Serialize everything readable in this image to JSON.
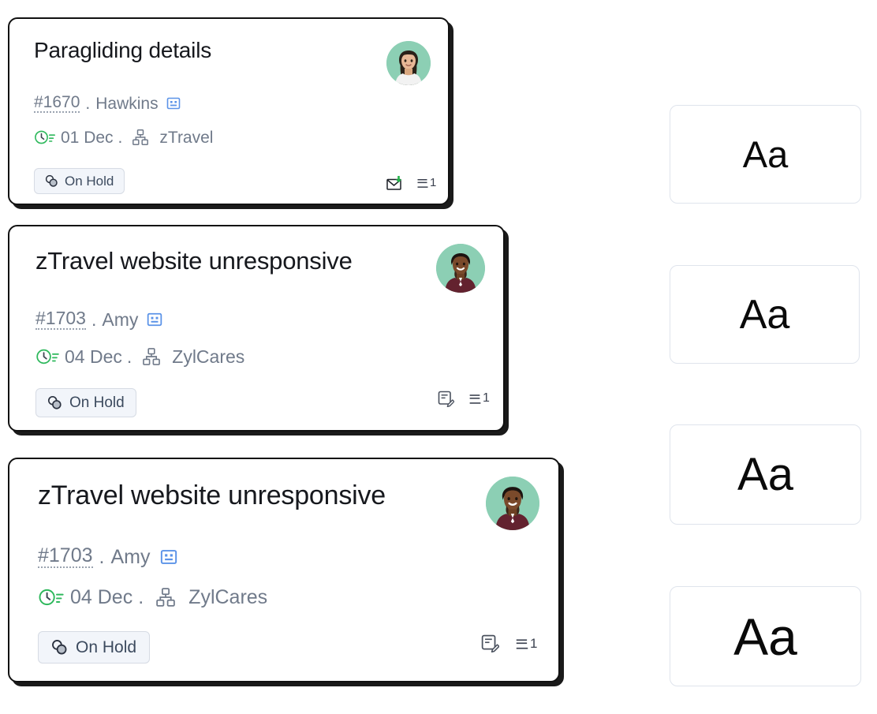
{
  "page": {
    "background": "#ffffff",
    "title": "Ticket card font size preview"
  },
  "cards": [
    {
      "title": "Paragliding details",
      "ticket_id": "#1670",
      "separator": ".",
      "requester": "Hawkins",
      "contact_icon": "contact-face-icon",
      "due_icon": "clock-due-icon",
      "due_date": "01 Dec",
      "due_separator": ".",
      "department_icon": "org-chart-icon",
      "department": "zTravel",
      "status": "On Hold",
      "status_icon": "on-hold-icon",
      "channel_icon": "incoming-mail-icon",
      "thread_icon": "thread-lines-icon",
      "thread_count": "1",
      "avatar": "female-agent-avatar"
    },
    {
      "title": "zTravel website unresponsive",
      "ticket_id": "#1703",
      "separator": ".",
      "requester": "Amy",
      "contact_icon": "contact-face-icon",
      "due_icon": "clock-due-icon",
      "due_date": "04 Dec",
      "due_separator": ".",
      "department_icon": "org-chart-icon",
      "department": "ZylCares",
      "status": "On Hold",
      "status_icon": "on-hold-icon",
      "channel_icon": "note-edit-icon",
      "thread_icon": "thread-lines-icon",
      "thread_count": "1",
      "avatar": "male-agent-avatar"
    },
    {
      "title": "zTravel website unresponsive",
      "ticket_id": "#1703",
      "separator": ".",
      "requester": "Amy",
      "contact_icon": "contact-face-icon",
      "due_icon": "clock-due-icon",
      "due_date": "04 Dec",
      "due_separator": ".",
      "department_icon": "org-chart-icon",
      "department": "ZylCares",
      "status": "On Hold",
      "status_icon": "on-hold-icon",
      "channel_icon": "note-edit-icon",
      "thread_icon": "thread-lines-icon",
      "thread_count": "1",
      "avatar": "male-agent-avatar"
    }
  ],
  "font_size_options": [
    {
      "sample": "Aa"
    },
    {
      "sample": "Aa"
    },
    {
      "sample": "Aa"
    },
    {
      "sample": "Aa"
    }
  ],
  "colors": {
    "card_border": "#111111",
    "card_shadow": "#1a1a1a",
    "title_text": "#16181d",
    "meta_text": "#707a8a",
    "status_bg": "#f2f5fa",
    "status_border": "#d6dbe4",
    "status_text": "#3c4a5e",
    "accent_green": "#2eb85c",
    "accent_blue": "#5b93e8",
    "box_border": "#dfe4ec",
    "avatar_bg": "#8ccfb4"
  }
}
